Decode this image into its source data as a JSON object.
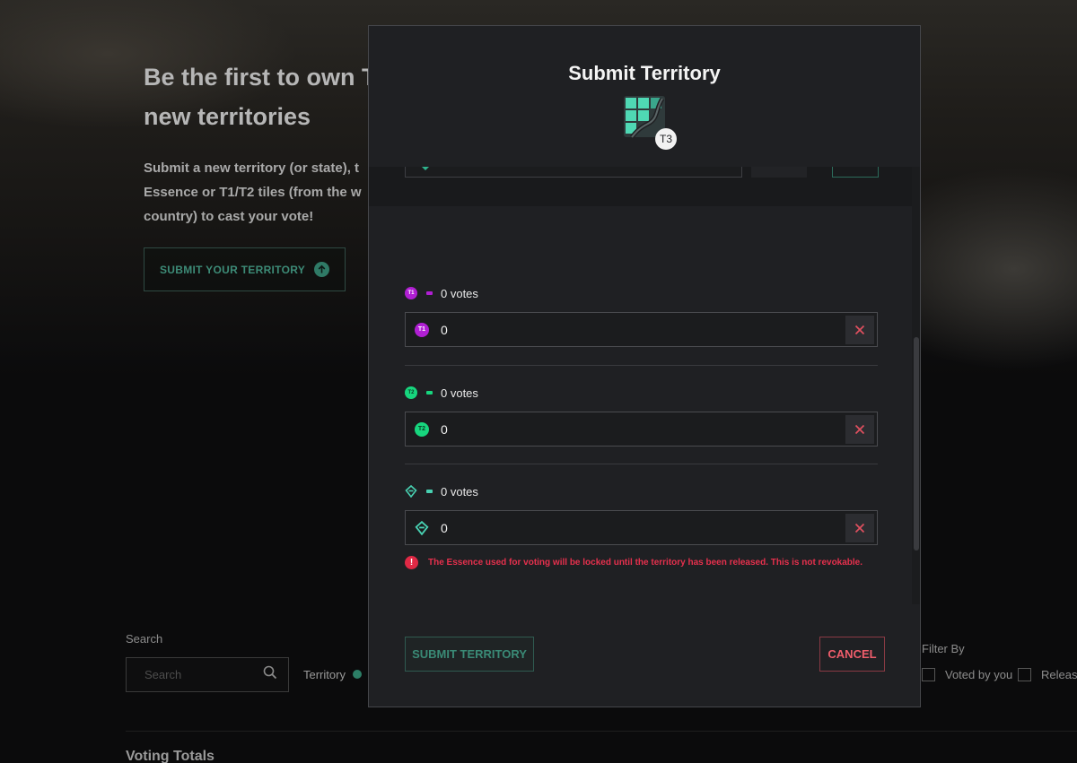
{
  "background": {
    "hero_title": "Be the first to own T\nnew territories",
    "hero_title_line1": "Be the first to own T",
    "hero_title_line2": "new territories",
    "hero_description": "Submit a new territory (or state), t\nEssence or T1/T2 tiles (from the w\ncountry) to cast your vote!",
    "hero_button_label": "SUBMIT YOUR TERRITORY",
    "search_label": "Search",
    "search_placeholder": "Search",
    "territory_label": "Territory",
    "filter_label": "Filter By",
    "filter_options": [
      "Voted by you",
      "Releas"
    ],
    "voting_totals_label": "Voting Totals"
  },
  "modal": {
    "title": "Submit Territory",
    "tier_badge": "T3",
    "votes": [
      {
        "token": "T1",
        "token_icon": "t1-token-icon",
        "color": "#b01fd3",
        "summary": "0 votes",
        "value": "0"
      },
      {
        "token": "T2",
        "token_icon": "t2-token-icon",
        "color": "#17d67e",
        "summary": "0 votes",
        "value": "0"
      },
      {
        "token": "Essence",
        "token_icon": "essence-icon",
        "color": "#48d1b2",
        "summary": "0 votes",
        "value": "0"
      }
    ],
    "warning": "The Essence used for voting will be locked until the territory has been released. This is not revokable.",
    "submit_label": "SUBMIT TERRITORY",
    "cancel_label": "CANCEL"
  },
  "colors": {
    "accent": "#2fb38d",
    "danger": "#e6304d",
    "modal_bg": "#1f2023"
  }
}
